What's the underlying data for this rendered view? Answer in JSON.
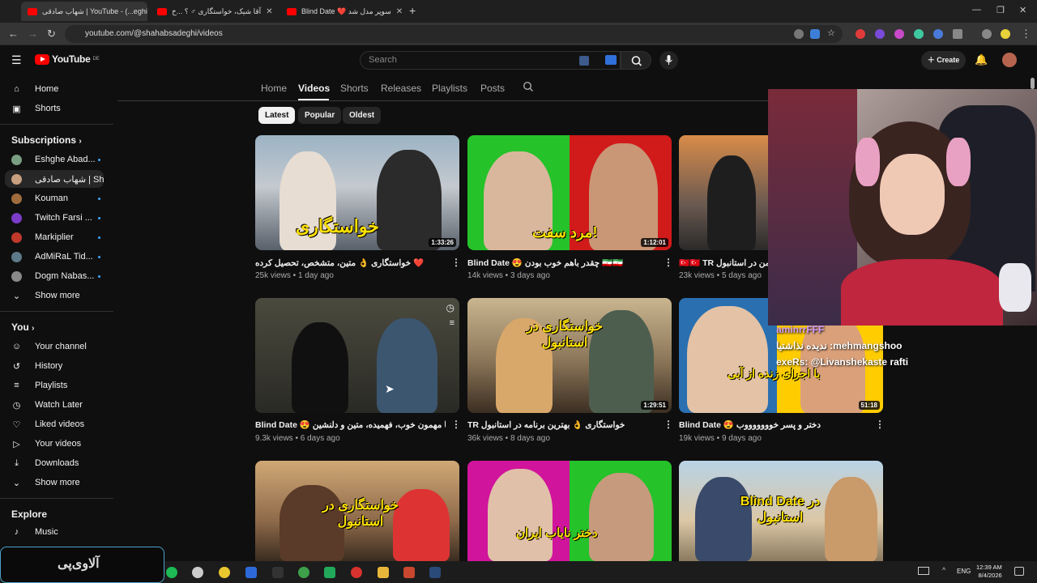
{
  "browser": {
    "tabs": [
      {
        "label": "شهاب صادقی | YouTube - (...eghi)",
        "active": true
      },
      {
        "label": "آقا شیک، خواستگاری ♂ ؟ ...خ",
        "active": false
      },
      {
        "label": "Blind Date ❤️ سوپر مدل شد",
        "active": false
      }
    ],
    "url": "youtube.com/@shahabsadeghi/videos"
  },
  "youtube": {
    "logo_text": "YouTube",
    "logo_country": "DE",
    "search_placeholder": "Search",
    "create_label": "Create"
  },
  "sidebar": {
    "top": [
      {
        "label": "Home",
        "icon": "home-icon"
      },
      {
        "label": "Shorts",
        "icon": "shorts-icon"
      }
    ],
    "subscriptions_title": "Subscriptions",
    "subscriptions": [
      {
        "label": "Eshghe Abad...",
        "color": "#7a9e82",
        "active": false
      },
      {
        "label": "شهاب صادقی | Sha...",
        "color": "#c8a080",
        "active": true
      },
      {
        "label": "Kouman",
        "color": "#a06c3d",
        "active": false
      },
      {
        "label": "Twitch Farsi ...",
        "color": "#7b3cc9",
        "active": false
      },
      {
        "label": "Markiplier",
        "color": "#c0392b",
        "active": false
      },
      {
        "label": "AdMiRaL Tid...",
        "color": "#5d7a8a",
        "active": false
      },
      {
        "label": "Dogm Nabas...",
        "color": "#8a8a8a",
        "active": false
      }
    ],
    "show_more_1": "Show more",
    "you_title": "You",
    "you_items": [
      {
        "label": "Your channel",
        "icon": "person-icon"
      },
      {
        "label": "History",
        "icon": "history-icon"
      },
      {
        "label": "Playlists",
        "icon": "playlist-icon"
      },
      {
        "label": "Watch Later",
        "icon": "clock-icon"
      },
      {
        "label": "Liked videos",
        "icon": "thumbs-up-icon"
      },
      {
        "label": "Your videos",
        "icon": "video-icon"
      },
      {
        "label": "Downloads",
        "icon": "download-icon"
      }
    ],
    "show_more_2": "Show more",
    "explore_title": "Explore",
    "explore_items": [
      {
        "label": "Music",
        "icon": "music-icon"
      }
    ]
  },
  "channel_tabs": [
    "Home",
    "Videos",
    "Shorts",
    "Releases",
    "Playlists",
    "Posts"
  ],
  "chips": [
    "Latest",
    "Popular",
    "Oldest"
  ],
  "videos": [
    {
      "title": "❤️ خواستگاری 👌 متین، متشخص، تحصیل کرده",
      "meta": "25k views • 1 day ago",
      "duration": "1:33:26",
      "overlay": "خواستگاری"
    },
    {
      "title": "Blind Date 😍 چقدر باهم خوب بودن 🇮🇷🇮🇷",
      "meta": "14k views • 3 days ago",
      "duration": "1:12:01",
      "overlay": "مرد سفت!"
    },
    {
      "title": "🇹🇷🇹🇷 TR ناسه من در استانبول",
      "meta": "23k views • 5 days ago",
      "duration": "",
      "overlay": ""
    },
    {
      "title": "Blind Date 😍 دو تا مهمون خوب، فهمیده، متین و دلنشین",
      "meta": "9.3k views • 6 days ago",
      "duration": "",
      "overlay": ""
    },
    {
      "title": "TR خواستگاری 👌 بهترین برنامه در استانبول",
      "meta": "36k views • 8 days ago",
      "duration": "1:29:51",
      "overlay": "خواستگاری در استانبول"
    },
    {
      "title": "Blind Date 😍 دختر و پسر خوووووووب",
      "meta": "19k views • 9 days ago",
      "duration": "51:18",
      "overlay": "با اجرای زنده از آبی"
    },
    {
      "title": "",
      "meta": "",
      "duration": "",
      "overlay": "خواستگاری در استانبول"
    },
    {
      "title": "",
      "meta": "",
      "duration": "",
      "overlay": "دختر نایاب ایران"
    },
    {
      "title": "",
      "meta": "",
      "duration": "",
      "overlay": "Blind Date در استانبول"
    }
  ],
  "stream_chat": [
    "aminrrFFF",
    "mehmangshoo: ندیده نذاشتیا",
    "exeRs: @Livanshekaste rafti"
  ],
  "ticker_text": "آلاوی‌پی",
  "taskbar": {
    "lang": "ENG",
    "time": "12:39 AM",
    "date": "8/4/2026"
  },
  "colors": {
    "accent_red": "#ff0000",
    "link_blue": "#3ea6ff",
    "bg": "#0f0f0f"
  }
}
